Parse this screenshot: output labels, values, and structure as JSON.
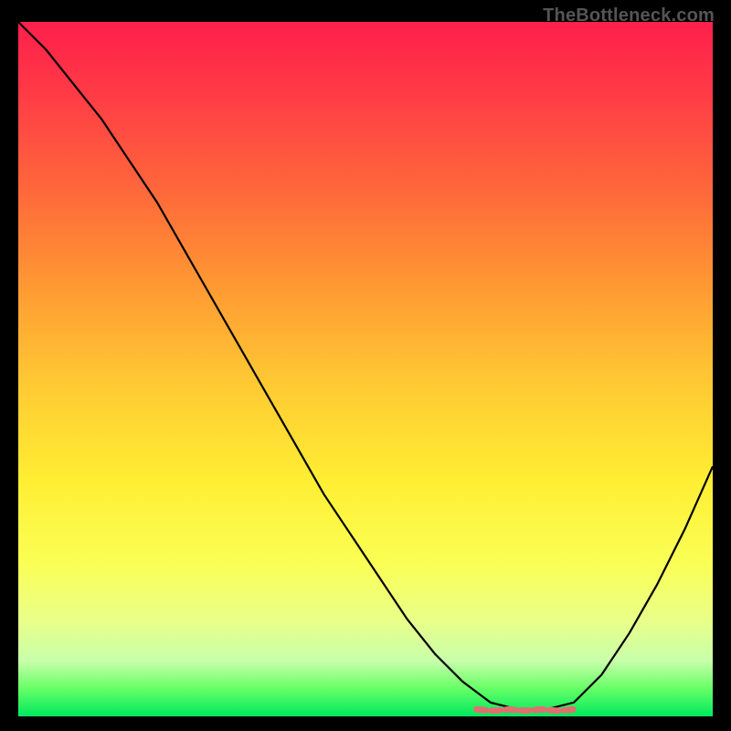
{
  "watermark": "TheBottleneck.com",
  "colors": {
    "curve": "#000000",
    "highlight": "#e07070",
    "bg_top": "#ff1f4b",
    "bg_bottom": "#00e85e"
  },
  "chart_data": {
    "type": "line",
    "title": "",
    "xlabel": "",
    "ylabel": "",
    "xlim": [
      0,
      100
    ],
    "ylim": [
      0,
      100
    ],
    "grid": false,
    "x": [
      0,
      4,
      8,
      12,
      16,
      20,
      24,
      28,
      32,
      36,
      40,
      44,
      48,
      52,
      56,
      60,
      64,
      68,
      72,
      76,
      80,
      84,
      88,
      92,
      96,
      100
    ],
    "y": [
      100,
      96,
      91,
      86,
      80,
      74,
      67,
      60,
      53,
      46,
      39,
      32,
      26,
      20,
      14,
      9,
      5,
      2,
      1,
      1,
      2,
      6,
      12,
      19,
      27,
      36
    ],
    "optimal_zone": {
      "x_start": 66,
      "x_end": 80,
      "y": 1
    }
  }
}
